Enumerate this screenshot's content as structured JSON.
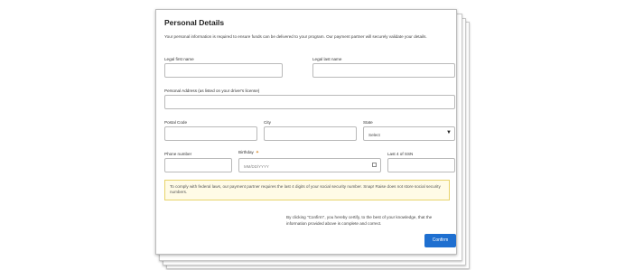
{
  "form": {
    "title": "Personal Details",
    "description": "Your personal information is required to ensure funds can be delivered to your program. Our payment partner will securely validate your details.",
    "fields": {
      "first_name": {
        "label": "Legal first name",
        "value": ""
      },
      "last_name": {
        "label": "Legal last name",
        "value": ""
      },
      "address": {
        "label": "Personal Address (as listed on your driver's license)",
        "value": ""
      },
      "postal_code": {
        "label": "Postal Code",
        "value": ""
      },
      "city": {
        "label": "City",
        "value": ""
      },
      "state": {
        "label": "State",
        "selected": "Select"
      },
      "phone": {
        "label": "Phone number",
        "value": ""
      },
      "birthday": {
        "label": "Birthday",
        "placeholder": "MM/DD/YYYY"
      },
      "ssn": {
        "label": "Last 4 of SSN",
        "value": ""
      }
    },
    "notice": "To comply with federal laws, our payment partner requires the last 4 digits of your social security number. Snap! Raise does not store social security numbers.",
    "consent": "By clicking \"Confirm\", you hereby certify, to the best of your knowledge, that the information provided above is complete and correct.",
    "confirm_label": "Confirm"
  },
  "icons": {
    "birthday": "cake-icon",
    "state_select": "caret-down-icon",
    "calendar": "calendar-icon"
  },
  "colors": {
    "accent": "#1e6fd0",
    "notice_bg": "#fffbe6",
    "notice_border": "#e8d36a"
  }
}
